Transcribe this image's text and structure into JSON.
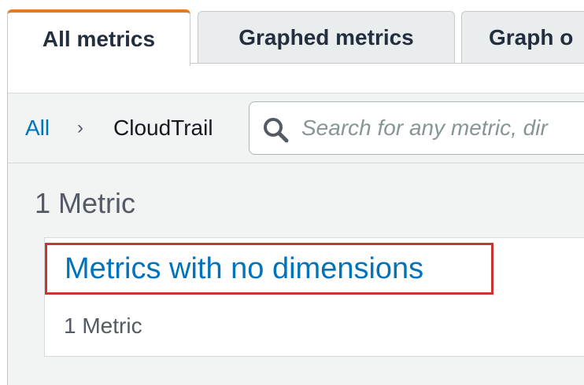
{
  "tabs": [
    {
      "label": "All metrics",
      "active": true
    },
    {
      "label": "Graphed metrics",
      "active": false
    },
    {
      "label": "Graph o",
      "active": false
    }
  ],
  "breadcrumb": {
    "root": "All",
    "separator": "›",
    "current": "CloudTrail"
  },
  "search": {
    "placeholder": "Search for any metric, dir",
    "value": ""
  },
  "main": {
    "count_label": "1 Metric",
    "groups": [
      {
        "title": "Metrics with no dimensions",
        "count_label": "1 Metric"
      }
    ]
  },
  "colors": {
    "accent_tab": "#e07b27",
    "link": "#0073bb",
    "highlight_box": "#c7372f"
  }
}
